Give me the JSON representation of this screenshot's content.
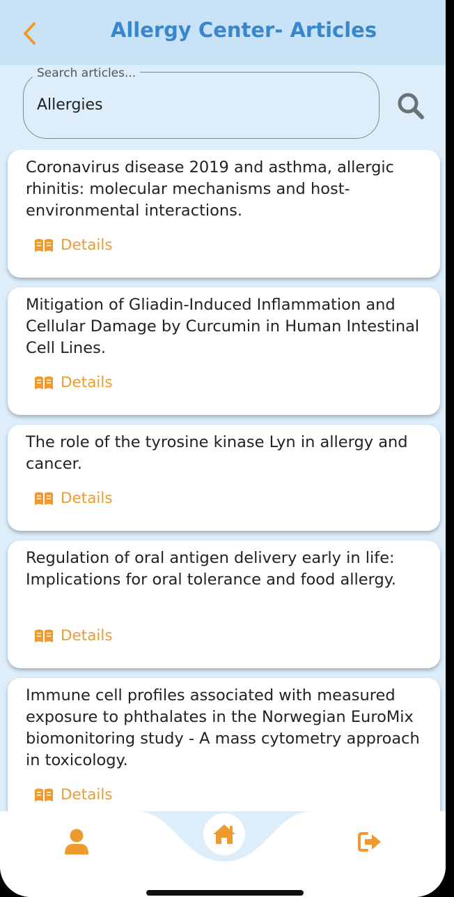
{
  "header": {
    "title": "Allergy Center- Articles"
  },
  "search": {
    "label": "Search articles...",
    "value": "Allergies"
  },
  "articles": [
    {
      "title": "Coronavirus disease 2019 and asthma, allergic rhinitis: molecular mechanisms and host-environmental interactions.",
      "details_label": "Details"
    },
    {
      "title": "Mitigation of Gliadin-Induced Inflammation and Cellular Damage by Curcumin in Human Intestinal Cell Lines.",
      "details_label": "Details"
    },
    {
      "title": "The role of the tyrosine kinase Lyn in allergy and cancer.",
      "details_label": "Details"
    },
    {
      "title": "Regulation of oral antigen delivery early in life: Implications for oral tolerance and food allergy.",
      "details_label": "Details"
    },
    {
      "title": "Immune cell profiles associated with measured exposure to phthalates in the Norwegian EuroMix biomonitoring study - A mass cytometry approach in toxicology.",
      "details_label": "Details"
    }
  ],
  "bottom_nav": {
    "items": [
      "user-icon",
      "home-icon",
      "logout-icon"
    ]
  },
  "colors": {
    "accent": "#ef9a2e",
    "title_blue": "#3a86cd",
    "header_bg": "#c8e2f6",
    "page_bg": "#ddeefa"
  }
}
